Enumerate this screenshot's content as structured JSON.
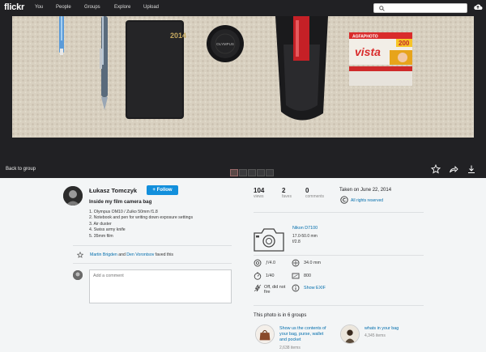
{
  "nav": {
    "logo": "flickr",
    "links": [
      "You",
      "People",
      "Groups",
      "Explore",
      "Upload"
    ],
    "search_placeholder": ""
  },
  "stage": {
    "back_label": "Back to group",
    "photo_content": {
      "notebook_text": "2014",
      "lens_cap_text": "OLYMPUS",
      "film_brand": "AGFAPHOTO",
      "film_name": "vista",
      "film_iso": "200"
    }
  },
  "owner": {
    "name": "Łukasz Tomczyk",
    "follow_label": "+ Follow"
  },
  "photo": {
    "title": "Inside my film camera bag",
    "description": [
      "1. Olympus OM10 / Zuiko 50mm f1.8",
      "2. Notebook and pen for writing down exposure settings",
      "3. Air duster",
      "4. Swiss army knife",
      "5. 35mm film"
    ],
    "faves": {
      "user1": "Martin Brigden",
      "and": "and",
      "user2": "Den Vorontsov",
      "suffix": "faved this"
    },
    "comment_placeholder": "Add a comment"
  },
  "stats": [
    {
      "value": "104",
      "label": "views"
    },
    {
      "value": "2",
      "label": "faves"
    },
    {
      "value": "0",
      "label": "comments"
    }
  ],
  "taken": "Taken on June 22, 2014",
  "rights": "All rights reserved",
  "camera": {
    "name": "Nikon D7100",
    "lens": "17.0-50.0 mm",
    "aperture": "f/2.8"
  },
  "exif": {
    "fstop": "ƒ/4.0",
    "focal": "34.0 mm",
    "shutter": "1/40",
    "iso": "800",
    "flash_line1": "Off, did not",
    "flash_line2": "fire",
    "show_exif": "Show EXIF"
  },
  "groups": {
    "title": "This photo is in 6 groups",
    "items": [
      {
        "line1": "Show us the contents of",
        "line2": "your bag, purse, wallet",
        "line3": "and pocket",
        "count": "2,638 items"
      },
      {
        "line1": "whats in your bag",
        "count": "4,345 items"
      }
    ]
  },
  "colors": {
    "nav_bg": "#212124",
    "accent_blue": "#128fdc",
    "link_blue": "#006dac",
    "page_bg": "#f3f5f6"
  }
}
